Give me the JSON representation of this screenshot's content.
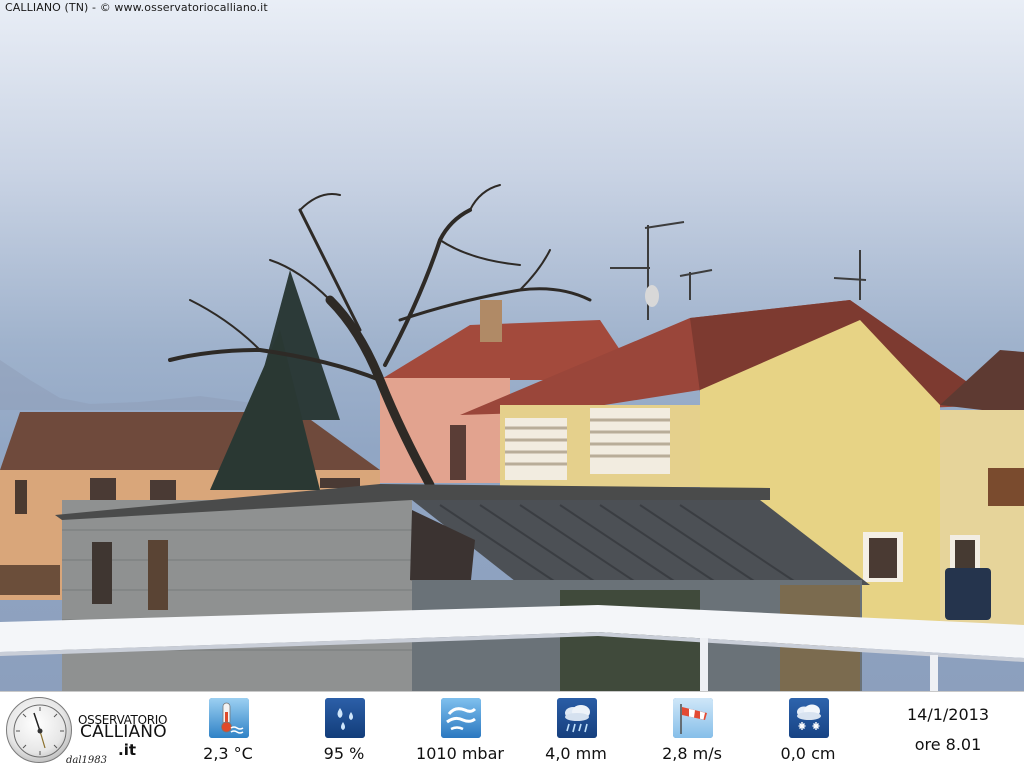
{
  "caption": "CALLIANO (TN) - © www.osservatoriocalliano.it",
  "logo": {
    "name_line1": "OSSERVATORIO",
    "name_line2": "CALLIANO",
    "domain": ".it",
    "since": "dal1983"
  },
  "metrics": [
    {
      "icon": "thermometer-icon",
      "value": "2,3 °C"
    },
    {
      "icon": "humidity-icon",
      "value": "95 %"
    },
    {
      "icon": "pressure-icon",
      "value": "1010 mbar"
    },
    {
      "icon": "rain-icon",
      "value": "4,0 mm"
    },
    {
      "icon": "wind-icon",
      "value": "2,8 m/s"
    },
    {
      "icon": "snow-icon",
      "value": "0,0 cm"
    }
  ],
  "datetime": {
    "date": "14/1/2013",
    "time": "ore 8.01"
  },
  "colors": {
    "icon_bg": "#2f6fb6",
    "roof": "#8a3e34",
    "wall_yellow": "#e3cf8a",
    "sky": "#a9bad2"
  }
}
